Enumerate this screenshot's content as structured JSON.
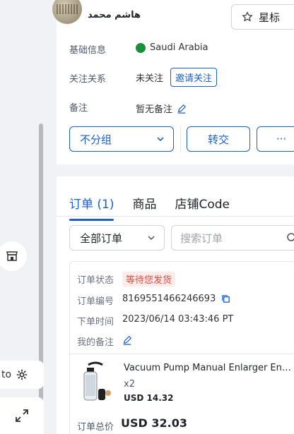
{
  "profile": {
    "name": "هاشم محمد",
    "star_label": "星标",
    "basic_info_label": "基础信息",
    "country": "Saudi Arabia",
    "follow_label": "关注关系",
    "follow_status": "未关注",
    "invite_button": "邀请关注",
    "note_label": "备注",
    "note_value": "暂无备注",
    "group_select": "不分组",
    "transfer_button": "转交",
    "more_button": "···"
  },
  "left": {
    "auto_text": "to"
  },
  "orders": {
    "tabs": [
      {
        "label": "订单 (1)",
        "active": true
      },
      {
        "label": "商品",
        "active": false
      },
      {
        "label": "店铺Code",
        "active": false
      }
    ],
    "filter_value": "全部订单",
    "search_placeholder": "搜索订单",
    "order": {
      "status_label": "订单状态",
      "status_value": "等待您发货",
      "number_label": "订单编号",
      "number_value": "8169551466246693",
      "time_label": "下单时间",
      "time_value": "2023/06/14 03:43:46 PT",
      "my_note_label": "我的备注",
      "product_title": "Vacuum Pump Manual Enlarger Enh...",
      "product_qty": "x2",
      "product_price": "USD 14.32",
      "total_label": "订单总价",
      "total_value": "USD 32.03"
    }
  },
  "colors": {
    "accent": "#1a5fd1",
    "status_red": "#e5483d",
    "background": "#f1f2f5"
  }
}
